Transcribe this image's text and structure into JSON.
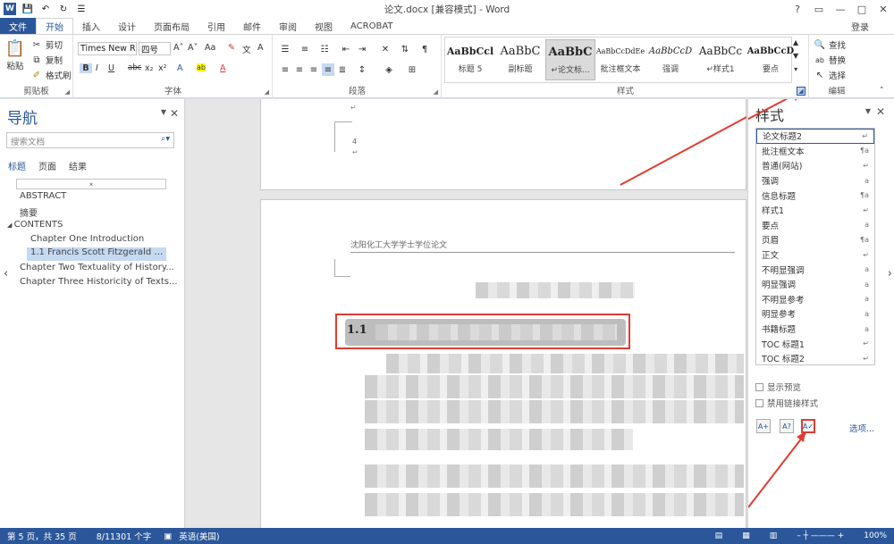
{
  "window": {
    "title": "论文.docx [兼容模式] - Word",
    "help": "?",
    "minimize": "—",
    "maximize": "□",
    "close": "✕"
  },
  "tabs": [
    "文件",
    "开始",
    "插入",
    "设计",
    "页面布局",
    "引用",
    "邮件",
    "审阅",
    "视图",
    "ACROBAT"
  ],
  "login": "登录",
  "clipboard": {
    "paste": "粘贴",
    "cut": "剪切",
    "copy": "复制",
    "format_painter": "格式刷",
    "label": "剪贴板"
  },
  "font": {
    "name": "Times New R",
    "size": "四号",
    "label": "字体",
    "bold": "B",
    "italic": "I",
    "underline": "U",
    "strike": "abc",
    "sub": "x₂",
    "sup": "x²",
    "grow": "A˄",
    "shrink": "A˅",
    "case": "Aa",
    "clear": "✎",
    "effects": "A",
    "highlight": "ab",
    "color": "A",
    "wen": "文",
    "circle": "A"
  },
  "paragraph": {
    "label": "段落"
  },
  "styles_gallery": {
    "label": "样式",
    "items": [
      {
        "preview": "AaBbCcl",
        "name": "标题 5"
      },
      {
        "preview": "AaBbC",
        "name": "副标题"
      },
      {
        "preview": "AaBbC",
        "name": "↵论文标..."
      },
      {
        "preview": "AaBbCcDdEe",
        "name": "批注框文本"
      },
      {
        "preview": "AaBbCcD",
        "name": "强调"
      },
      {
        "preview": "AaBbCc",
        "name": "↵样式1"
      },
      {
        "preview": "AaBbCcD",
        "name": "要点"
      }
    ]
  },
  "editing": {
    "find": "查找",
    "replace": "替换",
    "select": "选择",
    "label": "编辑"
  },
  "nav": {
    "title": "导航",
    "search_placeholder": "搜索文档",
    "tabs": [
      "标题",
      "页面",
      "结果"
    ],
    "headings": [
      "ABSTRACT",
      "摘要",
      "CONTENTS",
      "Chapter One Introduction",
      "1.1 Francis Scott Fitzgerald and...",
      "Chapter Two Textuality of History...",
      "Chapter Three Historicity of Texts..."
    ]
  },
  "document": {
    "header_text": "沈阳化工大学学士学位论文",
    "heading_prefix": "1.1",
    "page_num": "4"
  },
  "styles_pane": {
    "title": "样式",
    "items": [
      {
        "name": "论文标题2",
        "mark": "↵"
      },
      {
        "name": "批注框文本",
        "mark": "¶a"
      },
      {
        "name": "普通(网站)",
        "mark": "↵"
      },
      {
        "name": "强调",
        "mark": "a"
      },
      {
        "name": "信息标题",
        "mark": "¶a"
      },
      {
        "name": "样式1",
        "mark": "↵"
      },
      {
        "name": "要点",
        "mark": "a"
      },
      {
        "name": "页眉",
        "mark": "¶a"
      },
      {
        "name": "正文",
        "mark": "↵"
      },
      {
        "name": "不明显强调",
        "mark": "a"
      },
      {
        "name": "明显强调",
        "mark": "a"
      },
      {
        "name": "不明显参考",
        "mark": "a"
      },
      {
        "name": "明显参考",
        "mark": "a"
      },
      {
        "name": "书籍标题",
        "mark": "a"
      },
      {
        "name": "TOC 标题1",
        "mark": "↵"
      },
      {
        "name": "TOC 标题2",
        "mark": "↵"
      }
    ],
    "show_preview": "显示预览",
    "disable_linked": "禁用链接样式",
    "options": "选项..."
  },
  "status": {
    "page": "第 5 页，共 35 页",
    "words": "8/11301 个字",
    "lang": "英语(美国)",
    "zoom": "100%"
  },
  "colors": {
    "accent": "#2b579a",
    "red": "#e03c31"
  }
}
